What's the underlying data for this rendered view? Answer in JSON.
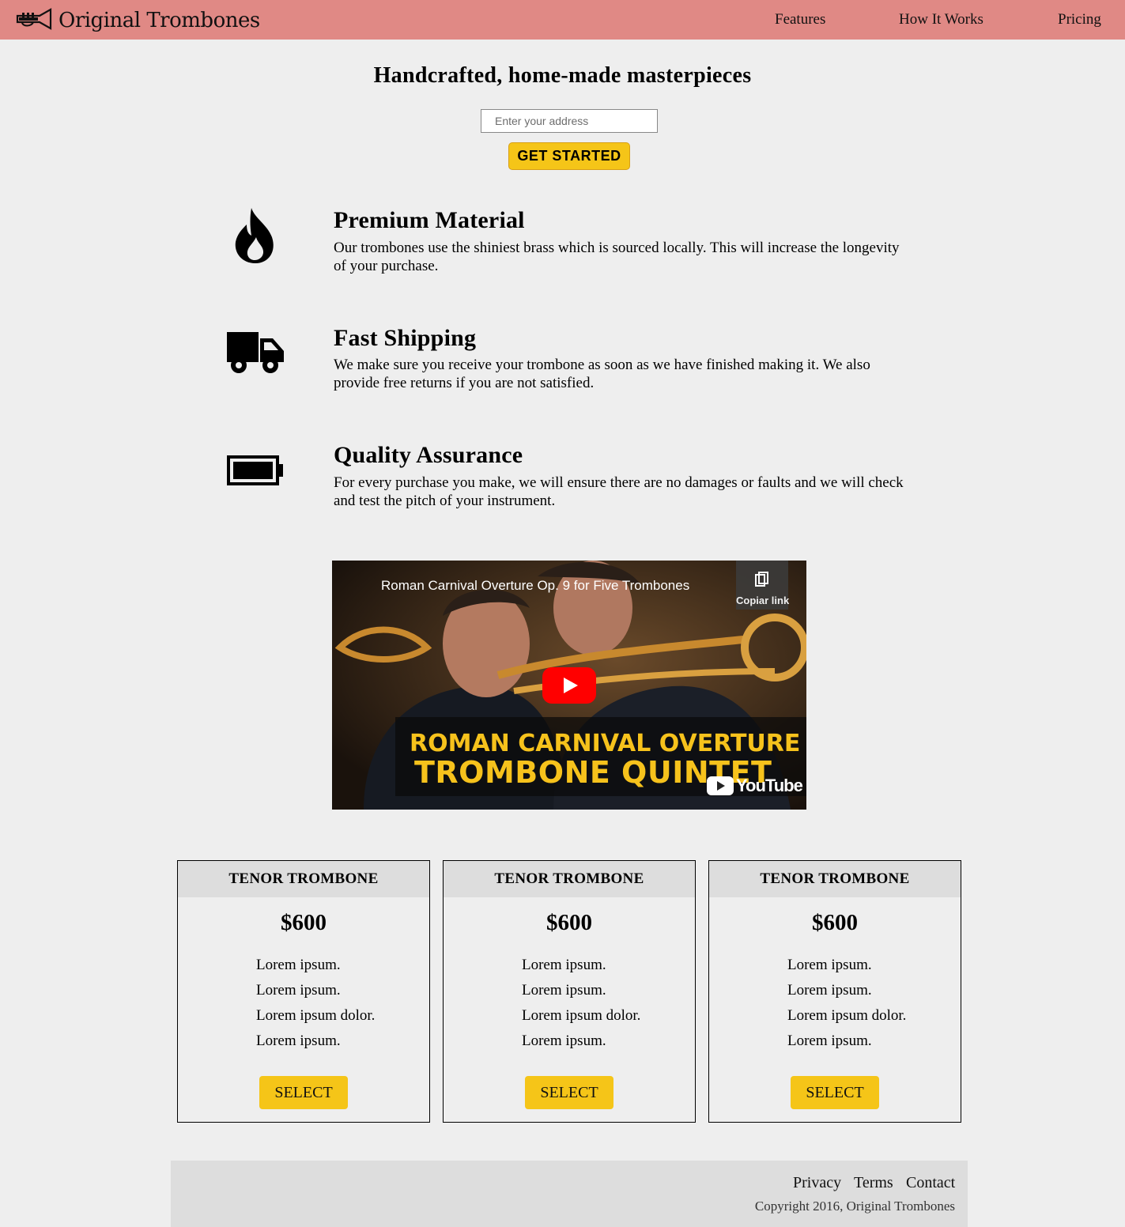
{
  "header": {
    "brand": "Original Trombones",
    "brand_icon": "trumpet-icon",
    "nav": [
      {
        "label": "Features"
      },
      {
        "label": "How It Works"
      },
      {
        "label": "Pricing"
      }
    ],
    "background": "#e08985"
  },
  "hero": {
    "title": "Handcrafted, home-made masterpieces",
    "input_placeholder": "Enter your address",
    "button_label": "GET STARTED",
    "button_color": "#f5c518"
  },
  "features": [
    {
      "icon": "fire-icon",
      "title": "Premium Material",
      "description": "Our trombones use the shiniest brass which is sourced locally. This will increase the longevity of your purchase."
    },
    {
      "icon": "truck-icon",
      "title": "Fast Shipping",
      "description": "We make sure you receive your trombone as soon as we have finished making it. We also provide free returns if you are not satisfied."
    },
    {
      "icon": "battery-full-icon",
      "title": "Quality Assurance",
      "description": "For every purchase you make, we will ensure there are no damages or faults and we will check and test the pitch of your instrument."
    }
  ],
  "video": {
    "title": "Roman Carnival Overture Op. 9 for Five Trombones",
    "copy_link_label": "Copiar link",
    "banner_line1": "ROMAN CARNIVAL OVERTURE",
    "banner_line2": "TROMBONE QUINTET",
    "platform": "YouTube"
  },
  "pricing": [
    {
      "name": "TENOR TROMBONE",
      "price": "$600",
      "features": [
        "Lorem ipsum.",
        "Lorem ipsum.",
        "Lorem ipsum dolor.",
        "Lorem ipsum."
      ],
      "button_label": "SELECT"
    },
    {
      "name": "TENOR TROMBONE",
      "price": "$600",
      "features": [
        "Lorem ipsum.",
        "Lorem ipsum.",
        "Lorem ipsum dolor.",
        "Lorem ipsum."
      ],
      "button_label": "SELECT"
    },
    {
      "name": "TENOR TROMBONE",
      "price": "$600",
      "features": [
        "Lorem ipsum.",
        "Lorem ipsum.",
        "Lorem ipsum dolor.",
        "Lorem ipsum."
      ],
      "button_label": "SELECT"
    }
  ],
  "footer": {
    "links": [
      {
        "label": "Privacy"
      },
      {
        "label": "Terms"
      },
      {
        "label": "Contact"
      }
    ],
    "copyright": "Copyright 2016, Original Trombones"
  }
}
